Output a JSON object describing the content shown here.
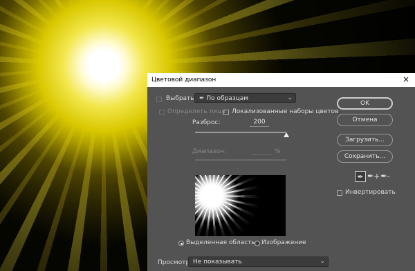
{
  "dialog": {
    "title": "Цветовой диапазон",
    "close_icon": "×"
  },
  "select": {
    "label": "Выбрать:",
    "value": "По образцам",
    "icon": "eyedropper-icon"
  },
  "options": {
    "detect_faces": "Определять лица",
    "localized": "Локализованные наборы цветов"
  },
  "fuzziness": {
    "label": "Разброс:",
    "value": "200",
    "level_fraction": 1.0
  },
  "range": {
    "label": "Диапазон:",
    "value": "",
    "unit": "%"
  },
  "preview_mode": {
    "selection": "Выделенная область",
    "image": "Изображение",
    "selected": "selection"
  },
  "view": {
    "label": "Просмотр:",
    "value": "Не показывать"
  },
  "buttons": {
    "ok": "OK",
    "cancel": "Отмена",
    "load": "Загрузить...",
    "save": "Сохранить..."
  },
  "eyedroppers": {
    "sample": "✒",
    "add": "✒+",
    "subtract": "✒-"
  },
  "invert": "Инвертировать",
  "colors": {
    "dialog_bg": "#535353",
    "titlebar_bg": "#ffffff",
    "field_bg": "#3c3c3c",
    "highlight": "#ffff66"
  }
}
